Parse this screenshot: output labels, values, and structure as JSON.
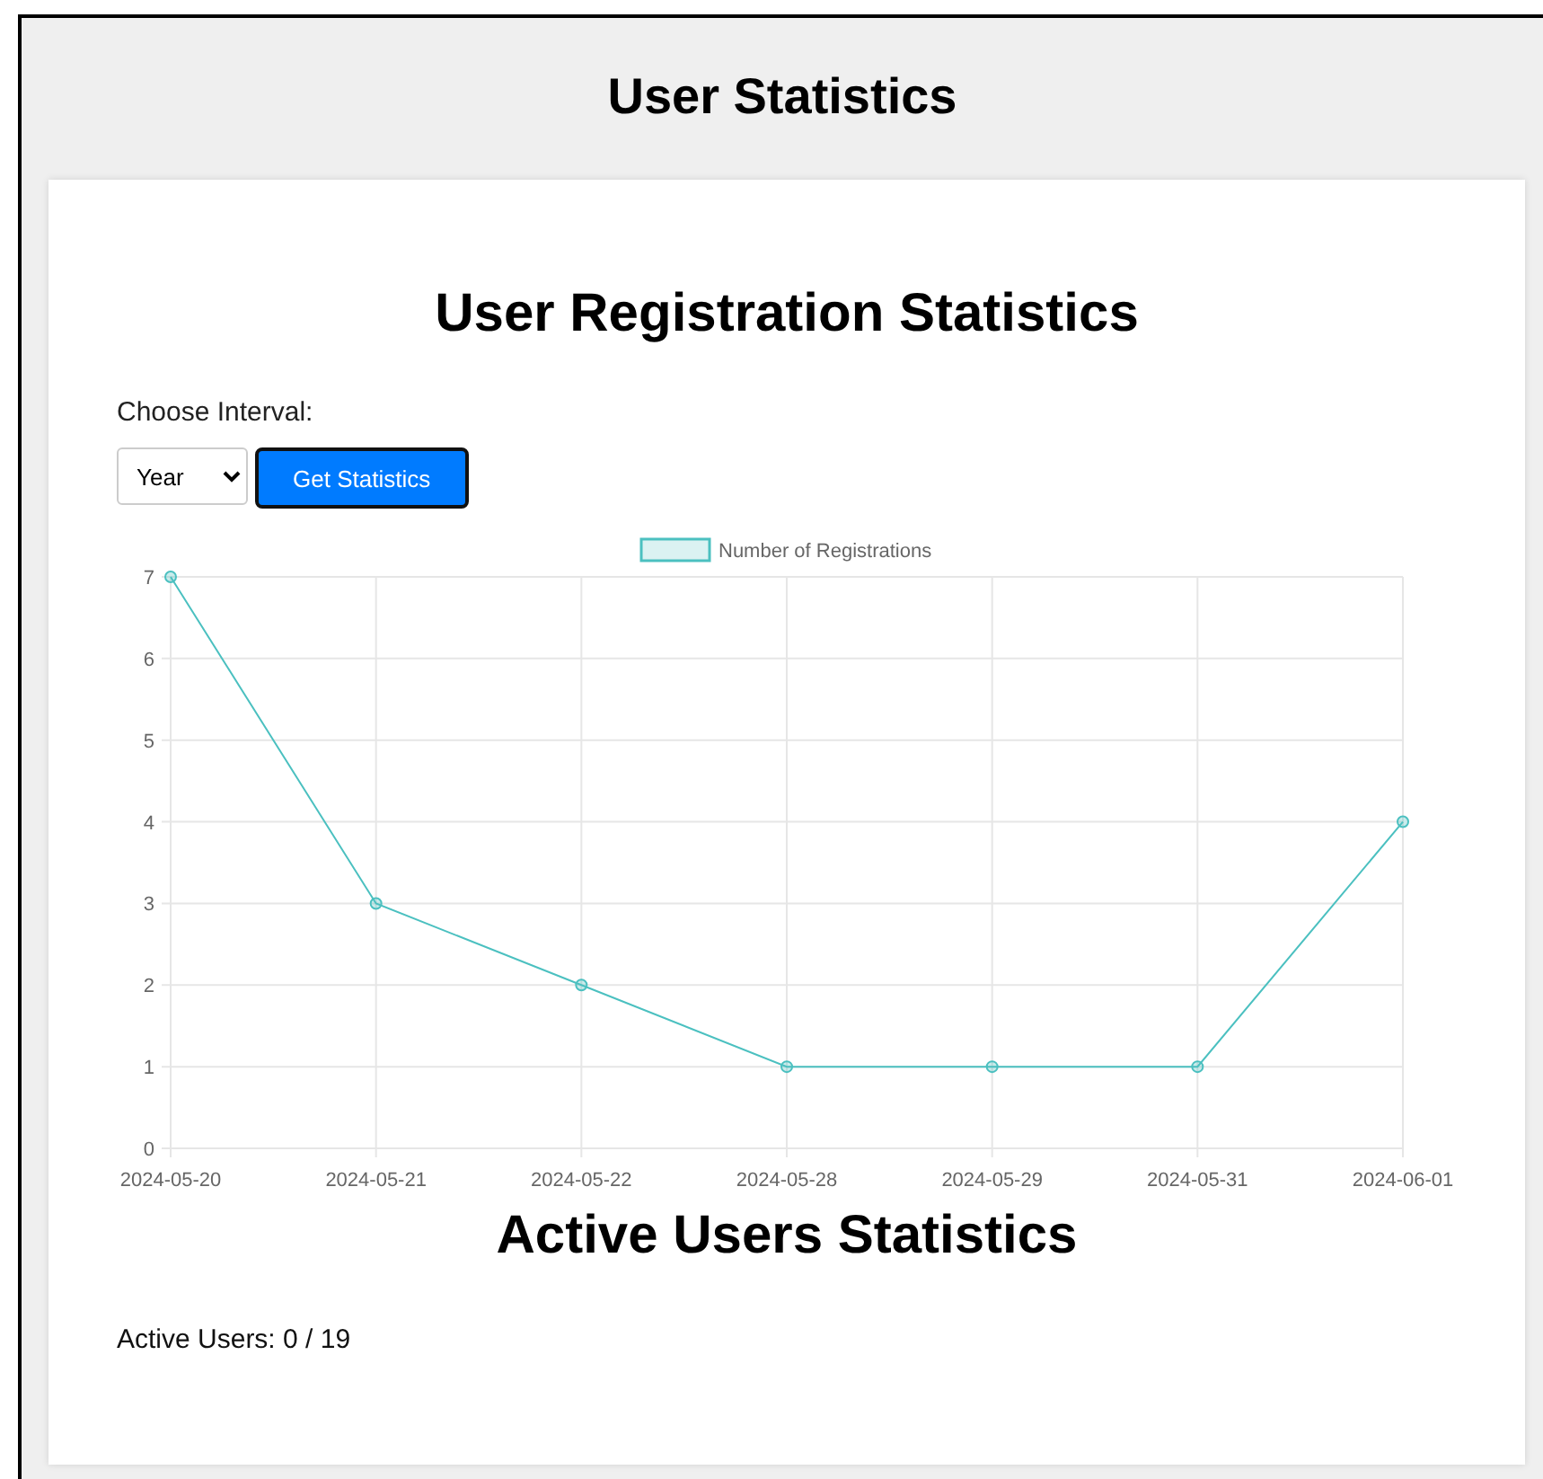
{
  "page_title": "User Statistics",
  "registration": {
    "heading": "User Registration Statistics",
    "interval_label": "Choose Interval:",
    "interval_value": "Year",
    "button": "Get Statistics",
    "chart_data": {
      "type": "line",
      "categories": [
        "2024-05-20",
        "2024-05-21",
        "2024-05-22",
        "2024-05-28",
        "2024-05-29",
        "2024-05-31",
        "2024-06-01"
      ],
      "ylim": [
        0,
        7
      ],
      "grid": true,
      "yticks": [
        0,
        1,
        2,
        3,
        4,
        5,
        6,
        7
      ],
      "series": [
        {
          "name": "Number of Registrations",
          "color": "#4bc0c0",
          "marker": "circle",
          "values": [
            7,
            3,
            2,
            1,
            1,
            1,
            4
          ]
        }
      ]
    }
  },
  "active": {
    "heading": "Active Users Statistics",
    "text": "Active Users: 0 / 19"
  }
}
